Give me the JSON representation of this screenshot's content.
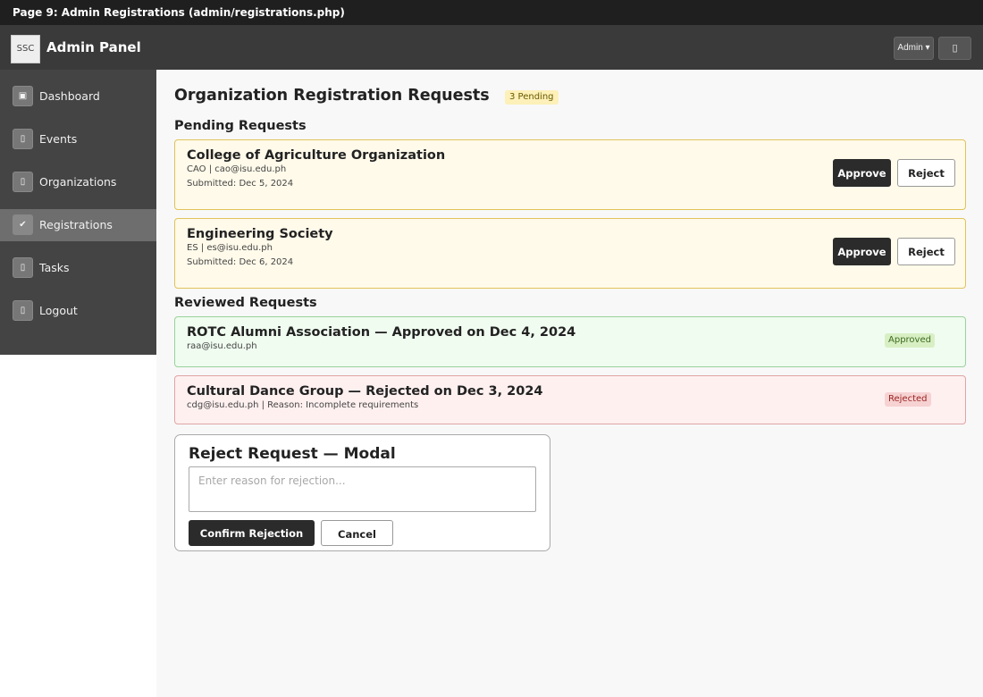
{
  "page_caption": "Page 9: Admin Registrations (admin/registrations.php)",
  "header": {
    "logo_text": "SSC",
    "title": "Admin Panel",
    "admin_menu_label": "Admin ▾",
    "action_button_icon": "▯"
  },
  "sidebar": {
    "items": [
      {
        "label": "Dashboard",
        "icon": "▣",
        "icon_name": "dashboard-icon",
        "active": false
      },
      {
        "label": "Events",
        "icon": "▯",
        "icon_name": "events-icon",
        "active": false
      },
      {
        "label": "Organizations",
        "icon": "▯",
        "icon_name": "organizations-icon",
        "active": false
      },
      {
        "label": "Registrations",
        "icon": "✔",
        "icon_name": "check-icon",
        "active": true
      },
      {
        "label": "Tasks",
        "icon": "▯",
        "icon_name": "tasks-icon",
        "active": false
      },
      {
        "label": "Logout",
        "icon": "▯",
        "icon_name": "logout-icon",
        "active": false
      }
    ]
  },
  "main": {
    "title": "Organization Registration Requests",
    "pending_badge": "3 Pending",
    "pending_section_title": "Pending Requests",
    "pending": [
      {
        "name": "College of Agriculture Organization",
        "contact": "CAO | cao@isu.edu.ph",
        "submitted": "Submitted: Dec 5, 2024",
        "approve_label": "Approve",
        "reject_label": "Reject"
      },
      {
        "name": "Engineering Society",
        "contact": "ES | es@isu.edu.ph",
        "submitted": "Submitted: Dec 6, 2024",
        "approve_label": "Approve",
        "reject_label": "Reject"
      }
    ],
    "reviewed_section_title": "Reviewed Requests",
    "reviewed": [
      {
        "title": "ROTC Alumni Association — Approved on Dec 4, 2024",
        "detail": "raa@isu.edu.ph",
        "status": "Approved"
      },
      {
        "title": "Cultural Dance Group — Rejected on Dec 3, 2024",
        "detail": "cdg@isu.edu.ph | Reason: Incomplete requirements",
        "status": "Rejected"
      }
    ]
  },
  "modal": {
    "title": "Reject Request — Modal",
    "reason_value": "",
    "reason_placeholder": "Enter reason for rejection...",
    "confirm_label": "Confirm Rejection",
    "cancel_label": "Cancel"
  },
  "colors": {
    "topbar": "#3a3a3a",
    "sidebar": "#444444",
    "pending_bg": "#fffaea",
    "approved_bg": "#f0fcf0",
    "rejected_bg": "#fff0f0",
    "primary_button": "#2b2b2b"
  }
}
